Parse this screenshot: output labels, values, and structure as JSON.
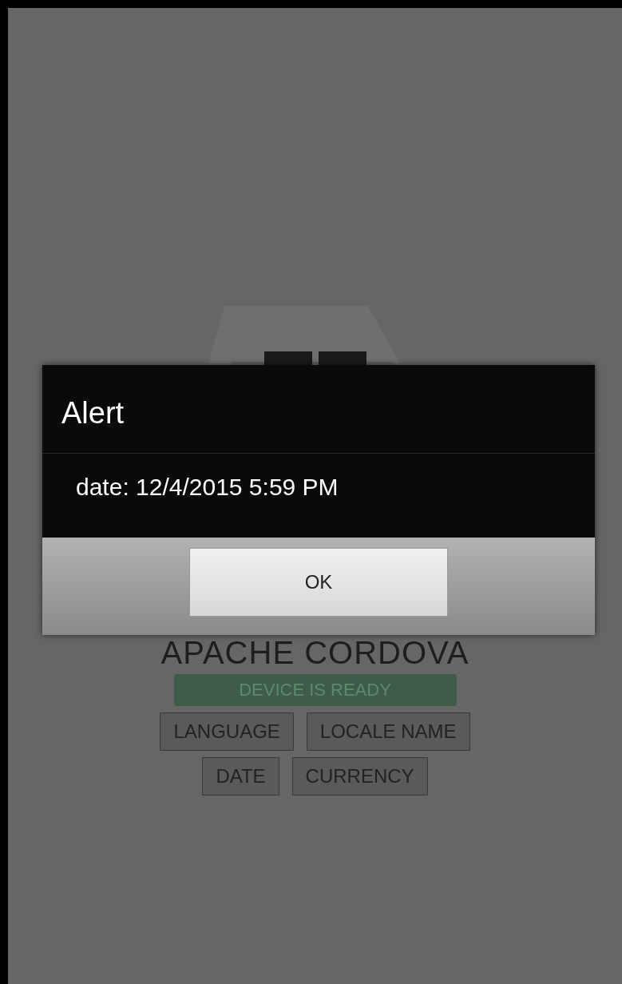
{
  "app": {
    "title": "APACHE CORDOVA",
    "status": "DEVICE IS READY",
    "button_rows": [
      {
        "buttons": [
          "LANGUAGE",
          "LOCALE NAME"
        ]
      },
      {
        "buttons": [
          "DATE",
          "CURRENCY"
        ]
      }
    ]
  },
  "dialog": {
    "title": "Alert",
    "message": "date: 12/4/2015 5:59 PM",
    "button": "OK"
  }
}
